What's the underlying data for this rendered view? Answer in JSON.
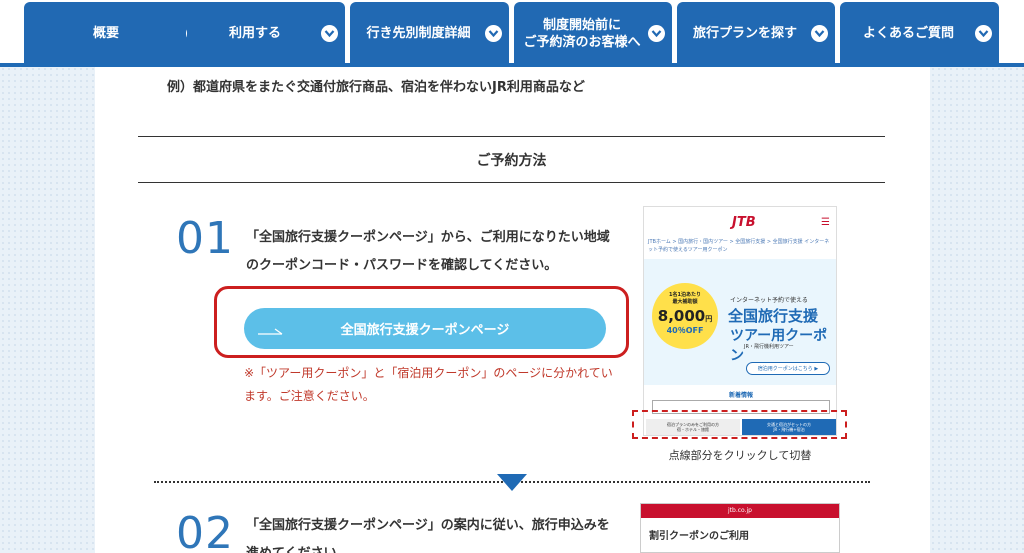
{
  "nav": {
    "tabs": [
      {
        "label": "概要"
      },
      {
        "label": "利用する"
      },
      {
        "label": "行き先別制度詳細"
      },
      {
        "label": "制度開始前に\nご予約済のお客様へ"
      },
      {
        "label": "旅行プランを探す"
      },
      {
        "label": "よくあるご質問"
      }
    ]
  },
  "content": {
    "example": "例）都道府県をまたぐ交通付旅行商品、宿泊を伴わないJR利用商品など",
    "section_title": "ご予約方法",
    "steps": [
      {
        "num": "01",
        "text": "「全国旅行支援クーポンページ」から、ご利用になりたい地域のクーポンコード・パスワードを確認してください。",
        "button_label": "全国旅行支援クーポンページ",
        "note": "※「ツアー用クーポン」と「宿泊用クーポン」のページに分かれています。ご注意ください。",
        "caption": "点線部分をクリックして切替"
      },
      {
        "num": "02",
        "text": "「全国旅行支援クーポンページ」の案内に従い、旅行申込みを進めてください。"
      }
    ]
  },
  "preview1": {
    "logo": "JTB",
    "crumbs": "JTBホーム > 国内旅行・国内ツアー > 全国旅行支援 > 全国旅行支援 インターネット予約で使えるツアー用クーポン",
    "badge_top": "1名1泊あたり\n最大補助額",
    "badge_amount": "8,000",
    "badge_unit": "円",
    "badge_off": "40％OFF",
    "small_top": "インターネット予約で使える",
    "big1": "全国旅行支援",
    "big2": "ツアー用クーポン",
    "sub": "JR・飛行機利用ツアー",
    "pill": "宿泊用クーポンはこちら ▶",
    "note_h": "新着情報",
    "tab_left": "宿泊プランのみをご利用の方\n宿・ホテル・旅館",
    "tab_right": "交通と宿泊がセットの方\nJR・飛行機+宿泊"
  },
  "preview2": {
    "bar": "jtb.co.jp",
    "title": "割引クーポンのご利用"
  },
  "colors": {
    "nav_blue": "#2169b3",
    "accent_red": "#cc1f1f",
    "button_blue": "#5cbfe8",
    "step_blue": "#2f76b8"
  }
}
